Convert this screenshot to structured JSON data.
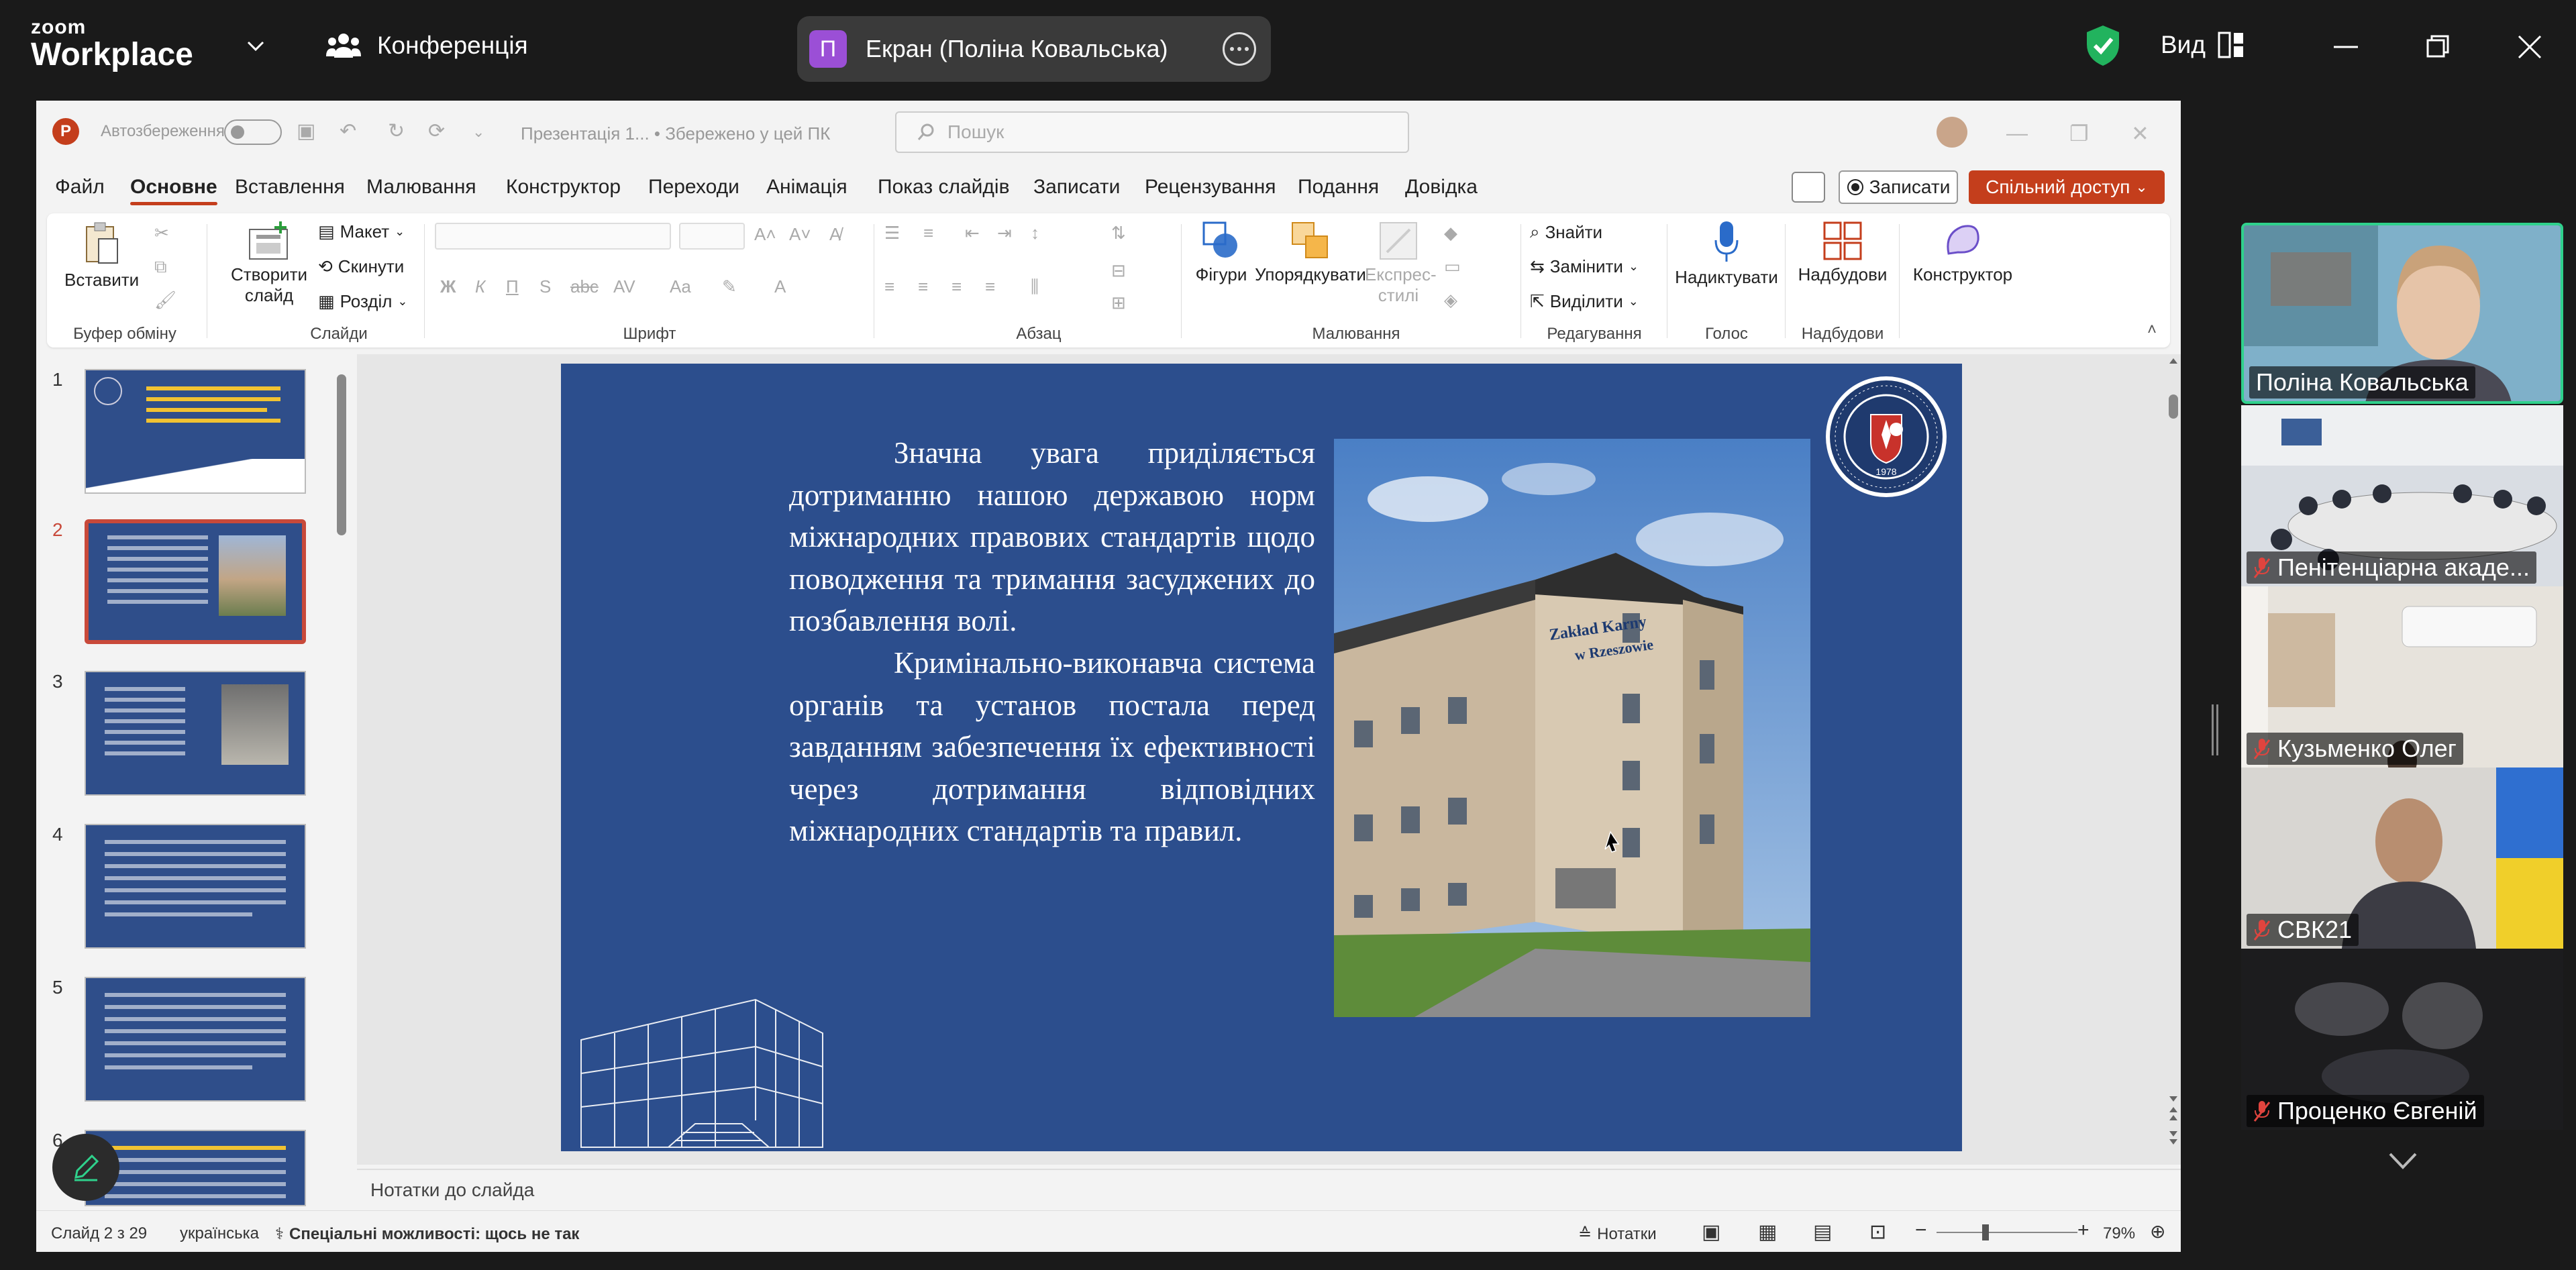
{
  "zoom": {
    "logo_small": "zoom",
    "logo_big": "Workplace",
    "conference_label": "Конференція",
    "share_avatar_letter": "П",
    "share_label": "Екран (Поліна Ковальська)",
    "view_label": "Вид"
  },
  "ppt": {
    "app_letter": "P",
    "autosave_label": "Автозбереження",
    "doc_title": "Презентація 1...  •  Збережено у цей ПК",
    "search_placeholder": "Пошук",
    "tabs": [
      "Файл",
      "Основне",
      "Вставлення",
      "Малювання",
      "Конструктор",
      "Переходи",
      "Анімація",
      "Показ слайдів",
      "Записати",
      "Рецензування",
      "Подання",
      "Довідка"
    ],
    "active_tab": "Основне",
    "record_label": "Записати",
    "share_label": "Спільний доступ",
    "ribbon": {
      "paste": "Вставити",
      "clipboard_group": "Буфер обміну",
      "new_slide_1": "Створити",
      "new_slide_2": "слайд",
      "layout": "Макет",
      "reset": "Скинути",
      "section": "Розділ",
      "slides_group": "Слайди",
      "font_group": "Шрифт",
      "paragraph_group": "Абзац",
      "shapes": "Фігури",
      "arrange": "Упорядкувати",
      "quick_styles_1": "Експрес-",
      "quick_styles_2": "стилі",
      "drawing_group": "Малювання",
      "find": "Знайти",
      "replace": "Замінити",
      "select": "Виділити",
      "editing_group": "Редагування",
      "dictate": "Надиктувати",
      "voice_group": "Голос",
      "addins": "Надбудови",
      "addins_group": "Надбудови",
      "designer": "Конструктор"
    },
    "thumbnails": [
      "1",
      "2",
      "3",
      "4",
      "5",
      "6"
    ],
    "selected_slide": "2",
    "slide": {
      "paragraph1": "Значна увага приділяється дотриманню нашою державою норм міжнародних правових стандартів щодо поводження та тримання засуджених до позбавлення волі.",
      "paragraph2": "Кримінально-виконавча система органів та установ постала перед завданням забезпечення їх ефективності через дотримання відповідних міжнародних стандартів та правил.",
      "photo_sign_line1": "Zakład Karny",
      "photo_sign_line2": "w Rzeszowie",
      "seal_year": "1978"
    },
    "notes_placeholder": "Нотатки до слайда",
    "status": {
      "slide_counter": "Слайд 2 з 29",
      "language": "українська",
      "accessibility": "Спеціальні можливості: щось не так",
      "notes": "Нотатки",
      "zoom_level": "79%"
    }
  },
  "participants": [
    {
      "name": "Поліна Ковальська",
      "muted": false
    },
    {
      "name": "Пенітенціарна акаде...",
      "muted": true
    },
    {
      "name": "Кузьменко Олег",
      "muted": true
    },
    {
      "name": "СВК21",
      "muted": true
    },
    {
      "name": "Проценко Євгеній",
      "muted": true
    }
  ],
  "colors": {
    "zoom_bg": "#1a1a1a",
    "ppt_accent": "#c43e1c",
    "slide_bg": "#2c4e8d",
    "active_speaker": "#2fd18c"
  }
}
